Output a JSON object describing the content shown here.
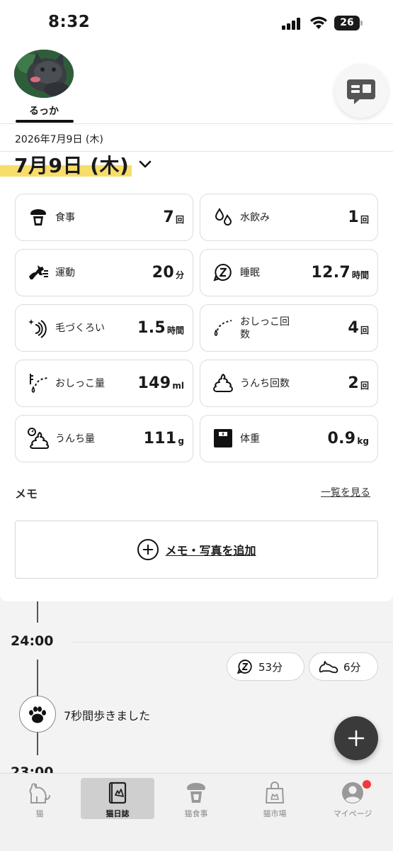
{
  "status_bar": {
    "time": "8:32",
    "battery": "26"
  },
  "profile": {
    "name": "るっか"
  },
  "date_header": {
    "small": "2026年7月9日 (木)",
    "big": "7月9日 (木)"
  },
  "stats": [
    {
      "label": "食事",
      "value": "7",
      "unit": "回",
      "icon": "food-bowl-icon"
    },
    {
      "label": "水飲み",
      "value": "1",
      "unit": "回",
      "icon": "water-drops-icon"
    },
    {
      "label": "運動",
      "value": "20",
      "unit": "分",
      "icon": "running-cat-icon"
    },
    {
      "label": "睡眠",
      "value": "12.7",
      "unit": "時間",
      "icon": "sleep-z-icon"
    },
    {
      "label": "毛づくろい",
      "value": "1.5",
      "unit": "時間",
      "icon": "grooming-icon"
    },
    {
      "label": "おしっこ回数",
      "value": "4",
      "unit": "回",
      "icon": "pee-count-icon"
    },
    {
      "label": "おしっこ量",
      "value": "149",
      "unit": "ml",
      "icon": "pee-volume-icon"
    },
    {
      "label": "うんち回数",
      "value": "2",
      "unit": "回",
      "icon": "poop-icon"
    },
    {
      "label": "うんち量",
      "value": "111",
      "unit": "g",
      "icon": "poop-weight-icon"
    },
    {
      "label": "体重",
      "value": "0.9",
      "unit": "kg",
      "icon": "scale-icon"
    }
  ],
  "stat_labels_wrapped": {
    "pee_count_line1": "おしっこ回",
    "pee_count_line2": "数"
  },
  "memo": {
    "title": "メモ",
    "view_all": "一覧を見る",
    "add": "メモ・写真を追加"
  },
  "timeline": {
    "hours": [
      "24:00",
      "23:00"
    ],
    "pills": [
      {
        "value": "53分",
        "icon": "sleep-z-icon"
      },
      {
        "value": "6分",
        "icon": "lying-cat-icon"
      }
    ],
    "event": "7秒間歩きました"
  },
  "tabs": [
    {
      "label": "猫",
      "icon": "cat-icon"
    },
    {
      "label": "猫日誌",
      "icon": "diary-icon"
    },
    {
      "label": "猫食事",
      "icon": "food-bowl-icon"
    },
    {
      "label": "猫市場",
      "icon": "shopping-bag-icon"
    },
    {
      "label": "マイページ",
      "icon": "user-icon"
    }
  ],
  "colors": {
    "highlight": "#f7dd6a",
    "fab": "#3a3a3a",
    "badge": "#f33a3a"
  }
}
